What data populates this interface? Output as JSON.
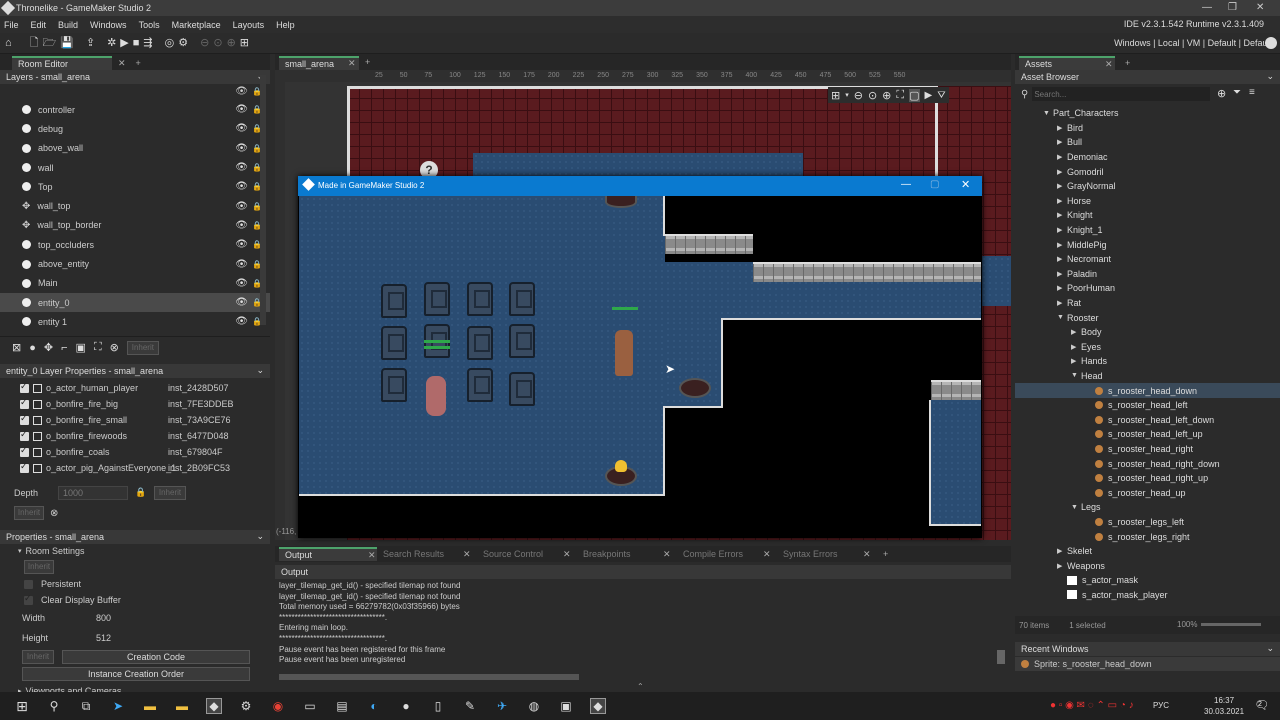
{
  "window": {
    "title": "Thronelike - GameMaker Studio 2"
  },
  "menu": [
    "File",
    "Edit",
    "Build",
    "Windows",
    "Tools",
    "Marketplace",
    "Layouts",
    "Help"
  ],
  "ide_info": "IDE v2.3.1.542  Runtime v2.3.1.409",
  "env_bar": "Windows | Local | VM | Default | Default",
  "room_editor": {
    "tab": "Room Editor",
    "layers_header": "Layers - small_arena",
    "layers": [
      "controller",
      "debug",
      "above_wall",
      "wall",
      "Top",
      "wall_top",
      "wall_top_border",
      "top_occluders",
      "above_entity",
      "Main",
      "entity_0",
      "entity 1"
    ],
    "inherit": "Inherit"
  },
  "layer_props": {
    "header": "entity_0 Layer Properties - small_arena",
    "instances": [
      {
        "name": "o_actor_human_player",
        "id": "inst_2428D507"
      },
      {
        "name": "o_bonfire_fire_big",
        "id": "inst_7FE3DDEB"
      },
      {
        "name": "o_bonfire_fire_small",
        "id": "inst_73A9CE76"
      },
      {
        "name": "o_bonfire_firewoods",
        "id": "inst_6477D048"
      },
      {
        "name": "o_bonfire_coals",
        "id": "inst_679804F"
      },
      {
        "name": "o_actor_pig_AgainstEveryone_1",
        "id": "inst_2B09FC53"
      }
    ],
    "depth_label": "Depth",
    "depth_value": "1000",
    "inherit": "Inherit"
  },
  "room_props": {
    "header": "Properties - small_arena",
    "room_settings": "Room Settings",
    "inherit": "Inherit",
    "persistent": "Persistent",
    "clear_display": "Clear Display Buffer",
    "width_label": "Width",
    "width_value": "800",
    "height_label": "Height",
    "height_value": "512",
    "creation_code": "Creation Code",
    "instance_order": "Instance Creation Order",
    "viewports": "Viewports and Cameras"
  },
  "room_tab": "small_arena",
  "ruler_ticks": [
    "25",
    "50",
    "75",
    "100",
    "125",
    "150",
    "175",
    "200",
    "225",
    "250",
    "275",
    "300",
    "325",
    "350",
    "375",
    "400",
    "425",
    "450",
    "475",
    "500",
    "525",
    "550"
  ],
  "coord": "(-116,",
  "game_window": {
    "title": "Made in GameMaker Studio 2"
  },
  "output": {
    "tabs": [
      "Output",
      "Search Results",
      "Source Control",
      "Breakpoints",
      "Compile Errors",
      "Syntax Errors"
    ],
    "header": "Output",
    "lines": [
      "layer_tilemap_get_id() - specified tilemap not found",
      "layer_tilemap_get_id() - specified tilemap not found",
      "Total memory used = 66279782(0x03f35966) bytes",
      "**********************************.",
      "Entering main loop.",
      "**********************************.",
      "Pause event has been registered for this frame",
      "Pause event has been unregistered"
    ]
  },
  "assets": {
    "tab": "Assets",
    "browser": "Asset Browser",
    "search_placeholder": "Search...",
    "tree": [
      {
        "label": "Part_Characters",
        "level": 1,
        "type": "folder",
        "open": true
      },
      {
        "label": "Bird",
        "level": 2,
        "type": "folder"
      },
      {
        "label": "Bull",
        "level": 2,
        "type": "folder"
      },
      {
        "label": "Demoniac",
        "level": 2,
        "type": "folder"
      },
      {
        "label": "Gomodril",
        "level": 2,
        "type": "folder"
      },
      {
        "label": "GrayNormal",
        "level": 2,
        "type": "folder"
      },
      {
        "label": "Horse",
        "level": 2,
        "type": "folder"
      },
      {
        "label": "Knight",
        "level": 2,
        "type": "folder"
      },
      {
        "label": "Knight_1",
        "level": 2,
        "type": "folder"
      },
      {
        "label": "MiddlePig",
        "level": 2,
        "type": "folder"
      },
      {
        "label": "Necromant",
        "level": 2,
        "type": "folder"
      },
      {
        "label": "Paladin",
        "level": 2,
        "type": "folder"
      },
      {
        "label": "PoorHuman",
        "level": 2,
        "type": "folder"
      },
      {
        "label": "Rat",
        "level": 2,
        "type": "folder"
      },
      {
        "label": "Rooster",
        "level": 2,
        "type": "folder",
        "open": true
      },
      {
        "label": "Body",
        "level": 3,
        "type": "folder"
      },
      {
        "label": "Eyes",
        "level": 3,
        "type": "folder"
      },
      {
        "label": "Hands",
        "level": 3,
        "type": "folder"
      },
      {
        "label": "Head",
        "level": 3,
        "type": "folder",
        "open": true
      },
      {
        "label": "s_rooster_head_down",
        "level": 4,
        "type": "sprite",
        "selected": true
      },
      {
        "label": "s_rooster_head_left",
        "level": 4,
        "type": "sprite"
      },
      {
        "label": "s_rooster_head_left_down",
        "level": 4,
        "type": "sprite"
      },
      {
        "label": "s_rooster_head_left_up",
        "level": 4,
        "type": "sprite"
      },
      {
        "label": "s_rooster_head_right",
        "level": 4,
        "type": "sprite"
      },
      {
        "label": "s_rooster_head_right_down",
        "level": 4,
        "type": "sprite"
      },
      {
        "label": "s_rooster_head_right_up",
        "level": 4,
        "type": "sprite"
      },
      {
        "label": "s_rooster_head_up",
        "level": 4,
        "type": "sprite"
      },
      {
        "label": "Legs",
        "level": 3,
        "type": "folder",
        "open": true
      },
      {
        "label": "s_rooster_legs_left",
        "level": 4,
        "type": "sprite"
      },
      {
        "label": "s_rooster_legs_right",
        "level": 4,
        "type": "sprite"
      },
      {
        "label": "Skelet",
        "level": 2,
        "type": "folder"
      },
      {
        "label": "Weapons",
        "level": 2,
        "type": "folder"
      },
      {
        "label": "s_actor_mask",
        "level": 2,
        "type": "white"
      },
      {
        "label": "s_actor_mask_player",
        "level": 2,
        "type": "white"
      }
    ],
    "count": "70 items",
    "selected": "1 selected",
    "zoom": "100%",
    "recent_header": "Recent Windows",
    "recent_item": "Sprite: s_rooster_head_down"
  },
  "taskbar": {
    "lang": "РУС",
    "time": "16:37",
    "date": "30.03.2021",
    "notif": "2"
  }
}
